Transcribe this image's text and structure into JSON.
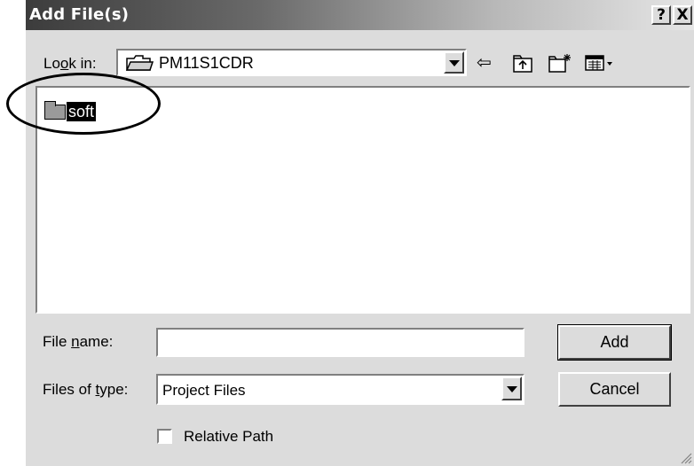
{
  "window": {
    "title": "Add File(s)",
    "help_button": "?",
    "close_button": "X"
  },
  "lookin": {
    "label_before": "Lo",
    "label_accel": "o",
    "label_after": "k in:",
    "value": "PM11S1CDR"
  },
  "toolbar": {
    "back_icon": "⇦",
    "up_icon": "⮤",
    "newfolder_icon": "✳",
    "view_icon": "▦▾"
  },
  "files": [
    {
      "name": "soft",
      "type": "folder",
      "selected": true
    }
  ],
  "filename": {
    "label_before": "File ",
    "label_accel": "n",
    "label_after": "ame:",
    "value": ""
  },
  "filetype": {
    "label_before": "Files of ",
    "label_accel": "t",
    "label_after": "ype:",
    "value": "Project Files"
  },
  "buttons": {
    "add": "Add",
    "cancel": "Cancel"
  },
  "relative_path": {
    "label": "Relative Path",
    "checked": false
  }
}
